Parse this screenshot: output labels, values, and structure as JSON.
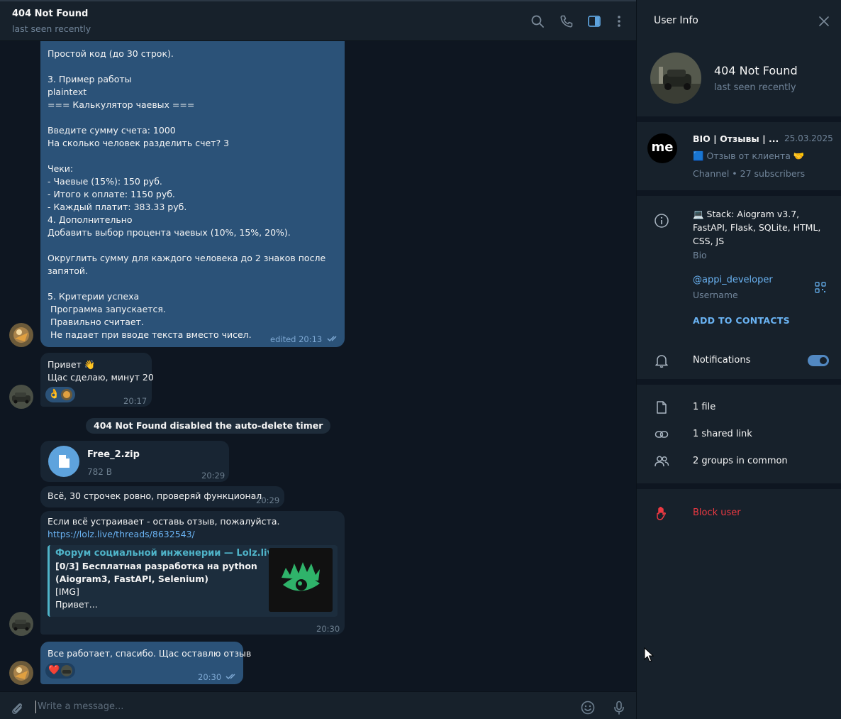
{
  "chat": {
    "title": "404 Not Found",
    "status": "last seen recently"
  },
  "messages": {
    "m1": {
      "lines": [
        "Простой код (до 30 строк).",
        "",
        "3. Пример работы",
        "plaintext",
        "=== Калькулятор чаевых ===",
        "",
        "Введите сумму счета: 1000",
        "На сколько человек разделить счет? 3",
        "",
        "Чеки:",
        "- Чаевые (15%): 150 руб.",
        "- Итого к оплате: 1150 руб.",
        "- Каждый платит: 383.33 руб.",
        "4. Дополнительно",
        "Добавить выбор процента чаевых (10%, 15%, 20%).",
        "",
        "Округлить сумму для каждого человека до 2 знаков после",
        "запятой.",
        "",
        "5. Критерии успеха",
        " Программа запускается.",
        " Правильно считает.",
        " Не падает при вводе текста вместо чисел."
      ],
      "time": "edited 20:13"
    },
    "m2": {
      "lines": [
        "Привет 👋",
        "Щас сделаю, минут 20"
      ],
      "reaction": "👌",
      "time": "20:17"
    },
    "service": "404 Not Found disabled the auto-delete timer",
    "file": {
      "name": "Free_2.zip",
      "size": "782 B",
      "time": "20:29"
    },
    "m3": {
      "text": "Всё, 30 строчек ровно, проверяй функционал",
      "time": "20:29"
    },
    "m4": {
      "text": "Если всё устраивает - оставь отзыв, пожалуйста.",
      "link": "https://lolz.live/threads/8632543/",
      "preview_site": "Форум социальной инженерии — Lolz.live...",
      "preview_lines": [
        "[0/3] Бесплатная разработка на python",
        "(Aiogram3, FastAPI, Selenium)"
      ],
      "preview_rest": [
        "[IMG]",
        "Привет..."
      ],
      "time": "20:30"
    },
    "m5": {
      "text": "Все работает, спасибо. Щас оставлю отзыв",
      "reaction": "❤️",
      "time": "20:30"
    }
  },
  "composer": {
    "placeholder": "Write a message..."
  },
  "info": {
    "title": "User Info",
    "name": "404 Not Found",
    "status": "last seen recently",
    "channel": {
      "logo": "me",
      "name": "BIO | Отзывы | ...",
      "date": "25.03.2025",
      "line2": "🟦 Отзыв от клиента 🤝",
      "line3": "Channel • 27 subscribers"
    },
    "bio": "💻 Stack: Aiogram v3.7, FastAPI, Flask, SQLite, HTML, CSS, JS",
    "bio_label": "Bio",
    "username": "@appi_developer",
    "username_label": "Username",
    "add_contacts": "ADD TO CONTACTS",
    "notifications": "Notifications",
    "notifications_on": true,
    "files": "1 file",
    "links": "1 shared link",
    "groups": "2 groups in common",
    "block": "Block user"
  },
  "colors": {
    "accent": "#5288c1",
    "link": "#6ab3f3",
    "danger": "#ec3942",
    "outgoing": "#2b5278",
    "incoming": "#182533"
  }
}
